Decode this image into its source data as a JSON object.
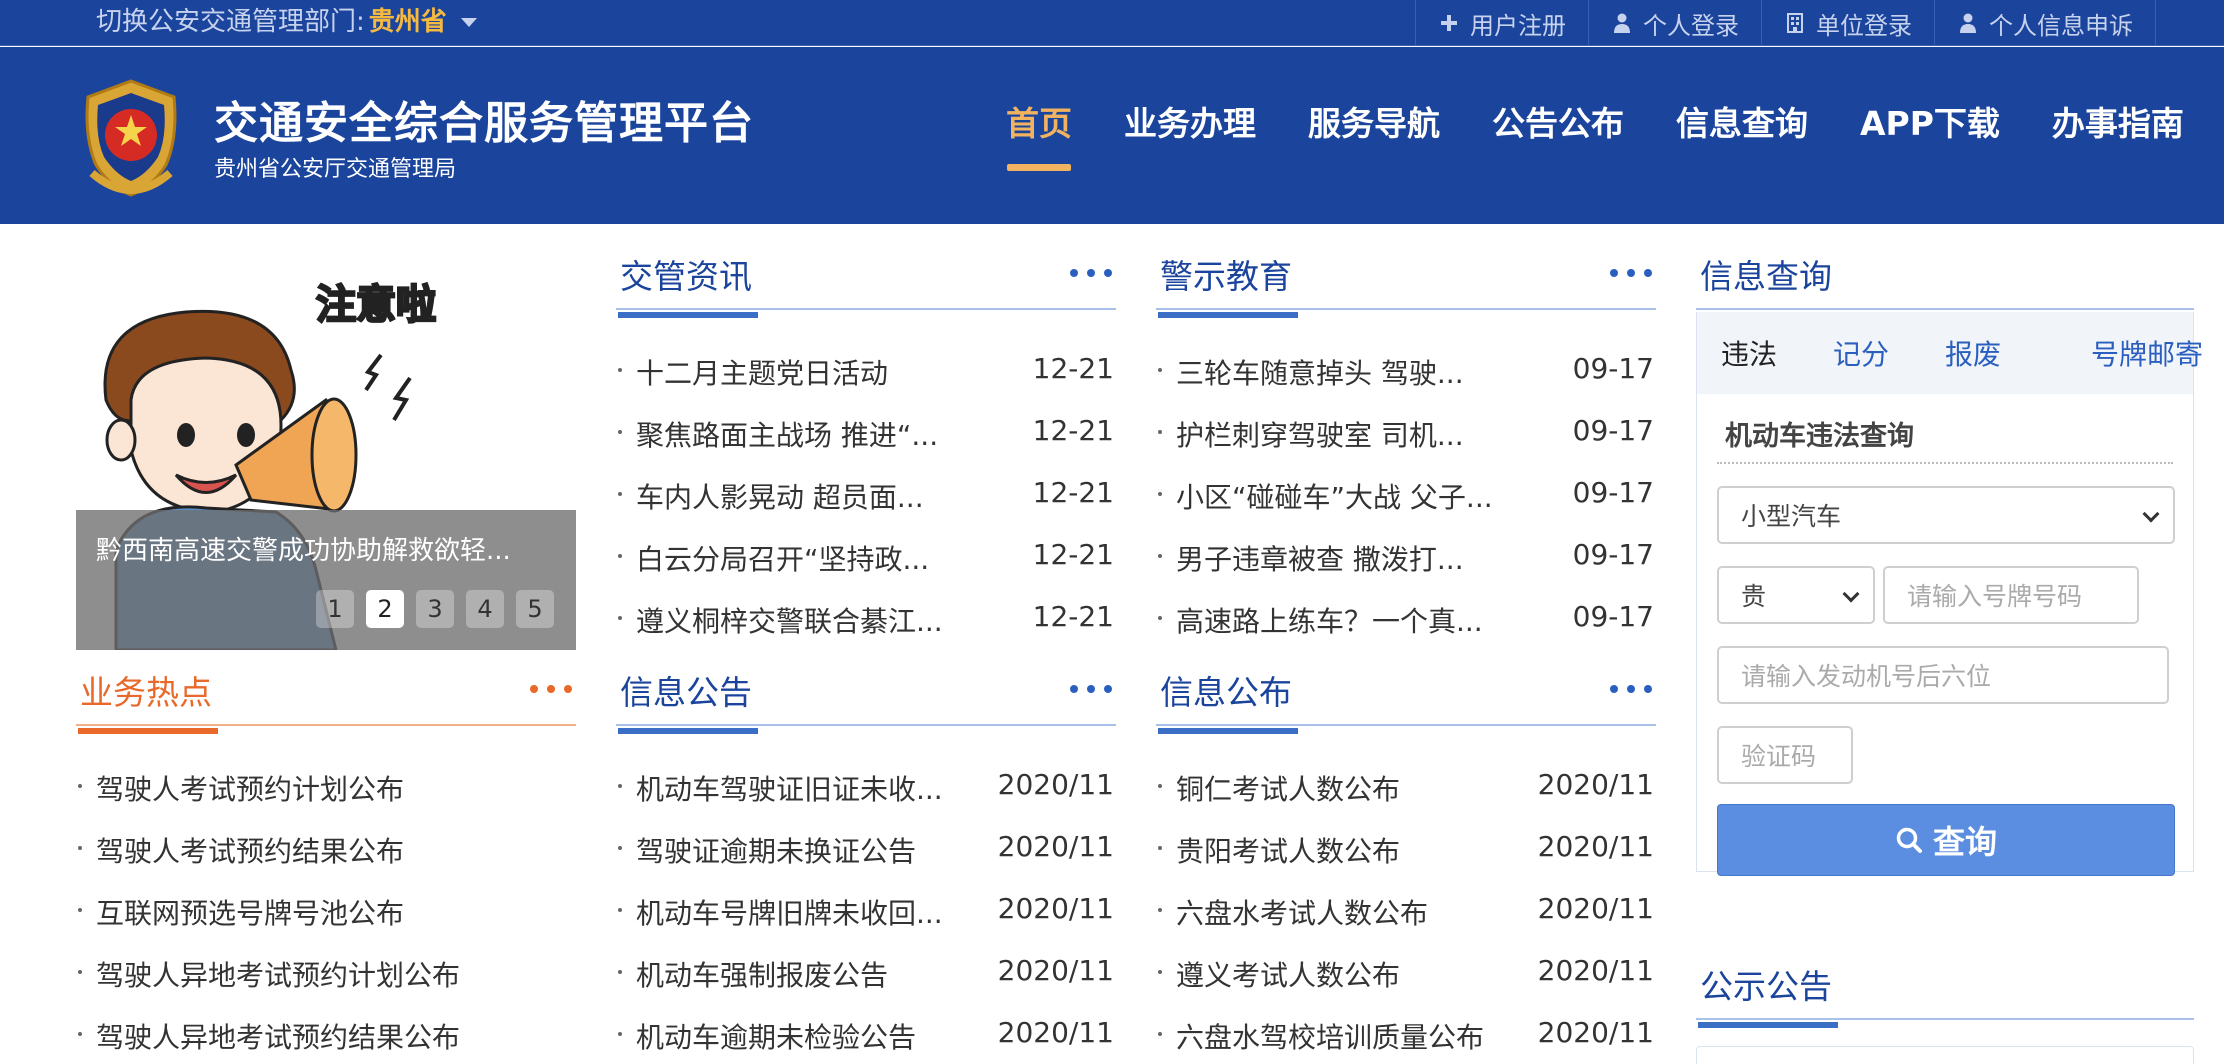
{
  "topbar": {
    "dept_label": "切换公安交通管理部门:",
    "dept_value": "贵州省",
    "links": [
      {
        "label": "用户注册",
        "icon": "plus-icon"
      },
      {
        "label": "个人登录",
        "icon": "person-icon"
      },
      {
        "label": "单位登录",
        "icon": "building-icon"
      },
      {
        "label": "个人信息申诉",
        "icon": "person-icon"
      }
    ]
  },
  "header": {
    "title": "交通安全综合服务管理平台",
    "subtitle": "贵州省公安厅交通管理局",
    "nav": [
      "首页",
      "业务办理",
      "服务导航",
      "公告公布",
      "信息查询",
      "APP下载",
      "办事指南"
    ],
    "active_nav": 0,
    "accent_color": "#f2b360",
    "brand_color": "#1b449c"
  },
  "carousel": {
    "image_text": "注意啦",
    "caption": "黔西南高速交警成功协助解救欲轻...",
    "pages": [
      "1",
      "2",
      "3",
      "4",
      "5"
    ],
    "active_page": 1
  },
  "hot": {
    "title": "业务热点",
    "items": [
      "驾驶人考试预约计划公布",
      "驾驶人考试预约结果公布",
      "互联网预选号牌号池公布",
      "驾驶人异地考试预约计划公布",
      "驾驶人异地考试预约结果公布"
    ]
  },
  "news": {
    "title": "交管资讯",
    "items": [
      {
        "text": "十二月主题党日活动",
        "date": "12-21"
      },
      {
        "text": "聚焦路面主战场 推进“...",
        "date": "12-21"
      },
      {
        "text": "车内人影晃动 超员面...",
        "date": "12-21"
      },
      {
        "text": "白云分局召开“坚持政...",
        "date": "12-21"
      },
      {
        "text": "遵义桐梓交警联合綦江...",
        "date": "12-21"
      }
    ]
  },
  "warning": {
    "title": "警示教育",
    "items": [
      {
        "text": "三轮车随意掉头 驾驶...",
        "date": "09-17"
      },
      {
        "text": "护栏刺穿驾驶室 司机...",
        "date": "09-17"
      },
      {
        "text": "小区“碰碰车”大战 父子...",
        "date": "09-17"
      },
      {
        "text": "男子违章被查 撒泼打...",
        "date": "09-17"
      },
      {
        "text": "高速路上练车？一个真...",
        "date": "09-17"
      }
    ]
  },
  "info_notice": {
    "title": "信息公告",
    "items": [
      {
        "text": "机动车驾驶证旧证未收...",
        "date": "2020/11"
      },
      {
        "text": "驾驶证逾期未换证公告",
        "date": "2020/11"
      },
      {
        "text": "机动车号牌旧牌未收回...",
        "date": "2020/11"
      },
      {
        "text": "机动车强制报废公告",
        "date": "2020/11"
      },
      {
        "text": "机动车逾期未检验公告",
        "date": "2020/11"
      }
    ]
  },
  "info_publish": {
    "title": "信息公布",
    "items": [
      {
        "text": "铜仁考试人数公布",
        "date": "2020/11"
      },
      {
        "text": "贵阳考试人数公布",
        "date": "2020/11"
      },
      {
        "text": "六盘水考试人数公布",
        "date": "2020/11"
      },
      {
        "text": "遵义考试人数公布",
        "date": "2020/11"
      },
      {
        "text": "六盘水驾校培训质量公布",
        "date": "2020/11"
      }
    ]
  },
  "query": {
    "title": "信息查询",
    "tabs": [
      "违法",
      "记分",
      "报废",
      "号牌邮寄"
    ],
    "active_tab": 0,
    "subtitle": "机动车违法查询",
    "vehicle_type": "小型汽车",
    "province": "贵",
    "plate_placeholder": "请输入号牌号码",
    "engine_placeholder": "请输入发动机号后六位",
    "captcha_placeholder": "验证码",
    "submit_label": "查询"
  },
  "notice": {
    "title": "公示公告"
  }
}
